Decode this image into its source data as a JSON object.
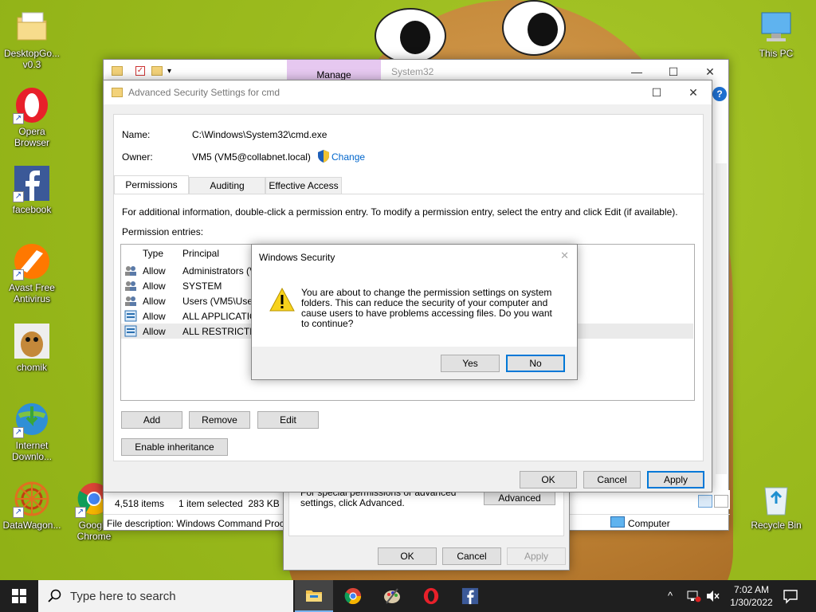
{
  "desktop": {
    "icons": [
      {
        "label": "DesktopGo... v0.3"
      },
      {
        "label": "Opera Browser"
      },
      {
        "label": "facebook"
      },
      {
        "label": "Avast Free Antivirus"
      },
      {
        "label": "chomik"
      },
      {
        "label": "Internet Downlo..."
      },
      {
        "label": "DataWagon..."
      },
      {
        "label": "Google Chrome"
      },
      {
        "label": "This PC"
      },
      {
        "label": "Recycle Bin"
      }
    ]
  },
  "explorer": {
    "ribbon_tab": "Manage",
    "title": "System32",
    "status_items": "4,518 items",
    "status_selected": "1 item selected  283 KB",
    "file_description": "File description: Windows Command Proc",
    "computer_label": "Computer"
  },
  "properties": {
    "hint": "For special permissions or advanced settings, click Advanced.",
    "advanced_button": "Advanced",
    "ok": "OK",
    "cancel": "Cancel",
    "apply": "Apply"
  },
  "advanced": {
    "title": "Advanced Security Settings for cmd",
    "name_label": "Name:",
    "name_value": "C:\\Windows\\System32\\cmd.exe",
    "owner_label": "Owner:",
    "owner_value": "VM5 (VM5@collabnet.local)",
    "change_link": "Change",
    "tabs": [
      {
        "label": "Permissions"
      },
      {
        "label": "Auditing"
      },
      {
        "label": "Effective Access"
      }
    ],
    "info_text": "For additional information, double-click a permission entry. To modify a permission entry, select the entry and click Edit (if available).",
    "entries_label": "Permission entries:",
    "columns": {
      "type": "Type",
      "principal": "Principal"
    },
    "rows": [
      {
        "type": "Allow",
        "principal": "Administrators (V"
      },
      {
        "type": "Allow",
        "principal": "SYSTEM"
      },
      {
        "type": "Allow",
        "principal": "Users (VM5\\User"
      },
      {
        "type": "Allow",
        "principal": "ALL APPLICATION"
      },
      {
        "type": "Allow",
        "principal": "ALL RESTRICTED"
      }
    ],
    "add": "Add",
    "remove": "Remove",
    "edit": "Edit",
    "enable_inheritance": "Enable inheritance",
    "ok": "OK",
    "cancel": "Cancel",
    "apply": "Apply"
  },
  "security_dialog": {
    "title": "Windows Security",
    "message": "You are about to change the permission settings on system folders. This can reduce the security of your computer and cause users to have problems accessing files. Do you want to continue?",
    "yes": "Yes",
    "no": "No"
  },
  "taskbar": {
    "search_placeholder": "Type here to search",
    "time": "7:02 AM",
    "date": "1/30/2022"
  },
  "colors": {
    "accent": "#0078d7",
    "manage_tab": "#e6c8f0",
    "link": "#0066cc",
    "selected_row": "#eaeaea",
    "taskbar": "#1f1f1f"
  }
}
